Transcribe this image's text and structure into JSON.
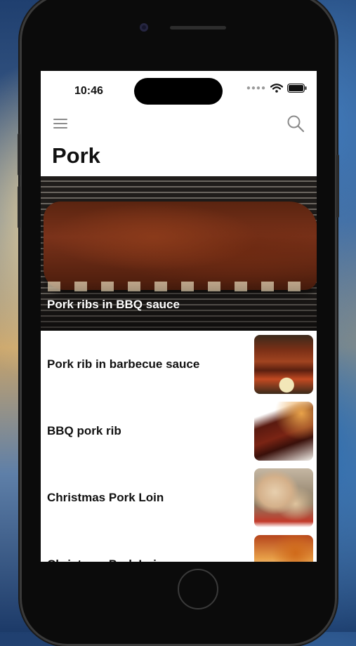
{
  "status_bar": {
    "time": "10:46"
  },
  "page": {
    "title": "Pork"
  },
  "featured": {
    "title": "Pork ribs in BBQ sauce"
  },
  "recipes": [
    {
      "title": "Pork rib in barbecue sauce"
    },
    {
      "title": "BBQ pork rib"
    },
    {
      "title": "Christmas Pork Loin"
    },
    {
      "title": "Christmas Pork Loin"
    }
  ],
  "icons": {
    "menu": "hamburger-menu-icon",
    "search": "search-icon",
    "wifi": "wifi-icon",
    "battery": "battery-icon",
    "signal": "signal-dots-icon"
  },
  "colors": {
    "title_text": "#111111",
    "icon_gray": "#8a8a8a"
  }
}
